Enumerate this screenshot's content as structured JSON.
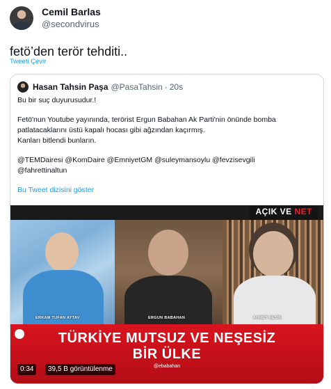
{
  "author": {
    "name": "Cemil Barlas",
    "handle": "@secondvirus"
  },
  "tweet": {
    "text": "fetö’den terör tehditi..",
    "translate_label": "Tweeti Çevir"
  },
  "quoted": {
    "name": "Hasan Tahsin Paşa",
    "handle": "@PasaTahsin",
    "separator": "·",
    "time": "20s",
    "lines": [
      "Bu bir suç duyurusudur.!",
      "",
      "Fetö'nun Youtube yayınında, terörist Ergun Babahan  Ak Parti'nin önünde bomba",
      "patlatacaklarını üstü kapalı hocası gibi ağzından kaçırmış.",
      "Kanları bitlendi bunların.",
      "",
      "@TEMDairesi @KomDaire @EmniyetGM  @suleymansoylu @fevzisevgili",
      "@fahrettinaltun"
    ],
    "thread_link": "Bu Tweet dizisini göster"
  },
  "video": {
    "channel_prefix": "AÇIK VE ",
    "channel_suffix": "NET",
    "guests": [
      "ERKAM TUFAN AYTAV",
      "ERGUN BABAHAN",
      "AHMET NESİN"
    ],
    "headline_line1": "TÜRKİYE MUTSUZ VE NEŞESİZ",
    "headline_line2": "BİR ÜLKE",
    "social": "@ebabahan",
    "duration": "0:34",
    "views": "39,5 B görüntülenme"
  },
  "colors": {
    "link": "#1d9bf0",
    "muted": "#536471",
    "red_bar": "#d9141e"
  }
}
